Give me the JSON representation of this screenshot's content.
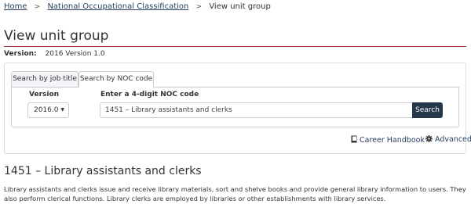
{
  "breadcrumb": {
    "home": "Home",
    "noc": "National Occupational Classification",
    "current": "View unit group",
    "separator": ">"
  },
  "page": {
    "title": "View unit group",
    "version_label": "Version:",
    "version_value": "2016 Version 1.0"
  },
  "tabs": [
    {
      "label": "Search by job title",
      "active": false
    },
    {
      "label": "Search by NOC code",
      "active": true
    }
  ],
  "form": {
    "version_label": "Version",
    "version_selected": "2016.0",
    "noc_label": "Enter a 4-digit NOC code",
    "noc_value": "1451 – Library assistants and clerks",
    "search_label": "Search"
  },
  "links": {
    "career_handbook": "Career Handbook",
    "advanced": "Advanced"
  },
  "result": {
    "title": "1451 – Library assistants and clerks",
    "description": "Library assistants and clerks issue and receive library materials, sort and shelve books and provide general library information to users. They also perform clerical functions. Library clerks are employed by libraries or other establishments with library services."
  },
  "colors": {
    "link": "#284162",
    "accent_rule": "#af3c43",
    "button": "#26374a"
  },
  "icons": [
    "book-icon",
    "gear-icon",
    "caret-down-icon"
  ]
}
